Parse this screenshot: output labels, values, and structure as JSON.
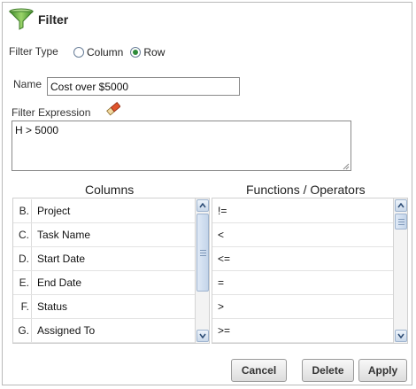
{
  "dialog": {
    "title": "Filter",
    "filter_type_label": "Filter Type",
    "filter_type_options": [
      {
        "label": "Column",
        "selected": false
      },
      {
        "label": "Row",
        "selected": true
      }
    ],
    "name_label": "Name",
    "name_value": "Cost over $5000",
    "expression_label": "Filter Expression",
    "expression_value": "H > 5000",
    "columns_header": "Columns",
    "functions_header": "Functions / Operators",
    "columns": [
      {
        "letter": "B.",
        "name": "Project"
      },
      {
        "letter": "C.",
        "name": "Task Name"
      },
      {
        "letter": "D.",
        "name": "Start Date"
      },
      {
        "letter": "E.",
        "name": "End Date"
      },
      {
        "letter": "F.",
        "name": "Status"
      },
      {
        "letter": "G.",
        "name": "Assigned To"
      }
    ],
    "functions": [
      "!=",
      "<",
      "<=",
      "=",
      ">",
      ">="
    ],
    "buttons": {
      "cancel": "Cancel",
      "delete": "Delete",
      "apply": "Apply"
    }
  },
  "colors": {
    "radio_selected": "#2e8b3a",
    "funnel_green": "#5aa83a",
    "scroll_accent": "#9fb4cf"
  },
  "icons": {
    "title": "funnel-icon",
    "clear_expression": "eraser-icon"
  }
}
